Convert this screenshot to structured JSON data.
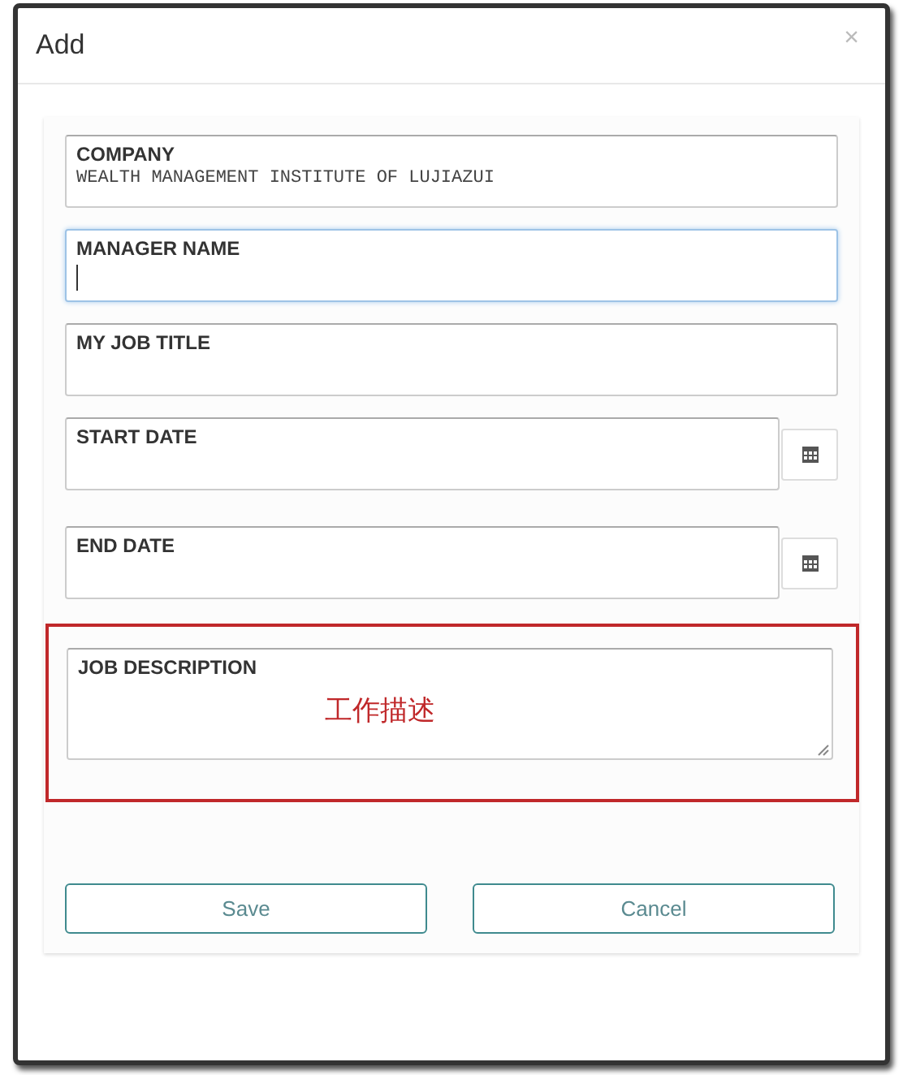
{
  "dialog": {
    "title": "Add",
    "close": "×"
  },
  "fields": [
    {
      "kind": "text",
      "label": "COMPANY",
      "value": "WEALTH MANAGEMENT INSTITUTE OF LUJIAZUI",
      "focused": false,
      "highlighted": false
    },
    {
      "kind": "text",
      "label": "MANAGER NAME",
      "focused": true,
      "highlighted": false
    },
    {
      "kind": "text",
      "label": "MY JOB TITLE",
      "focused": false,
      "highlighted": false
    },
    {
      "kind": "date",
      "label": "START DATE",
      "focused": false,
      "highlighted": false
    },
    {
      "kind": "date",
      "label": "END DATE",
      "focused": false,
      "highlighted": false
    },
    {
      "kind": "textarea",
      "label": "JOB DESCRIPTION",
      "annotation": "工作描述",
      "focused": false,
      "highlighted": true
    }
  ],
  "buttons": [
    "Save",
    "Cancel"
  ]
}
